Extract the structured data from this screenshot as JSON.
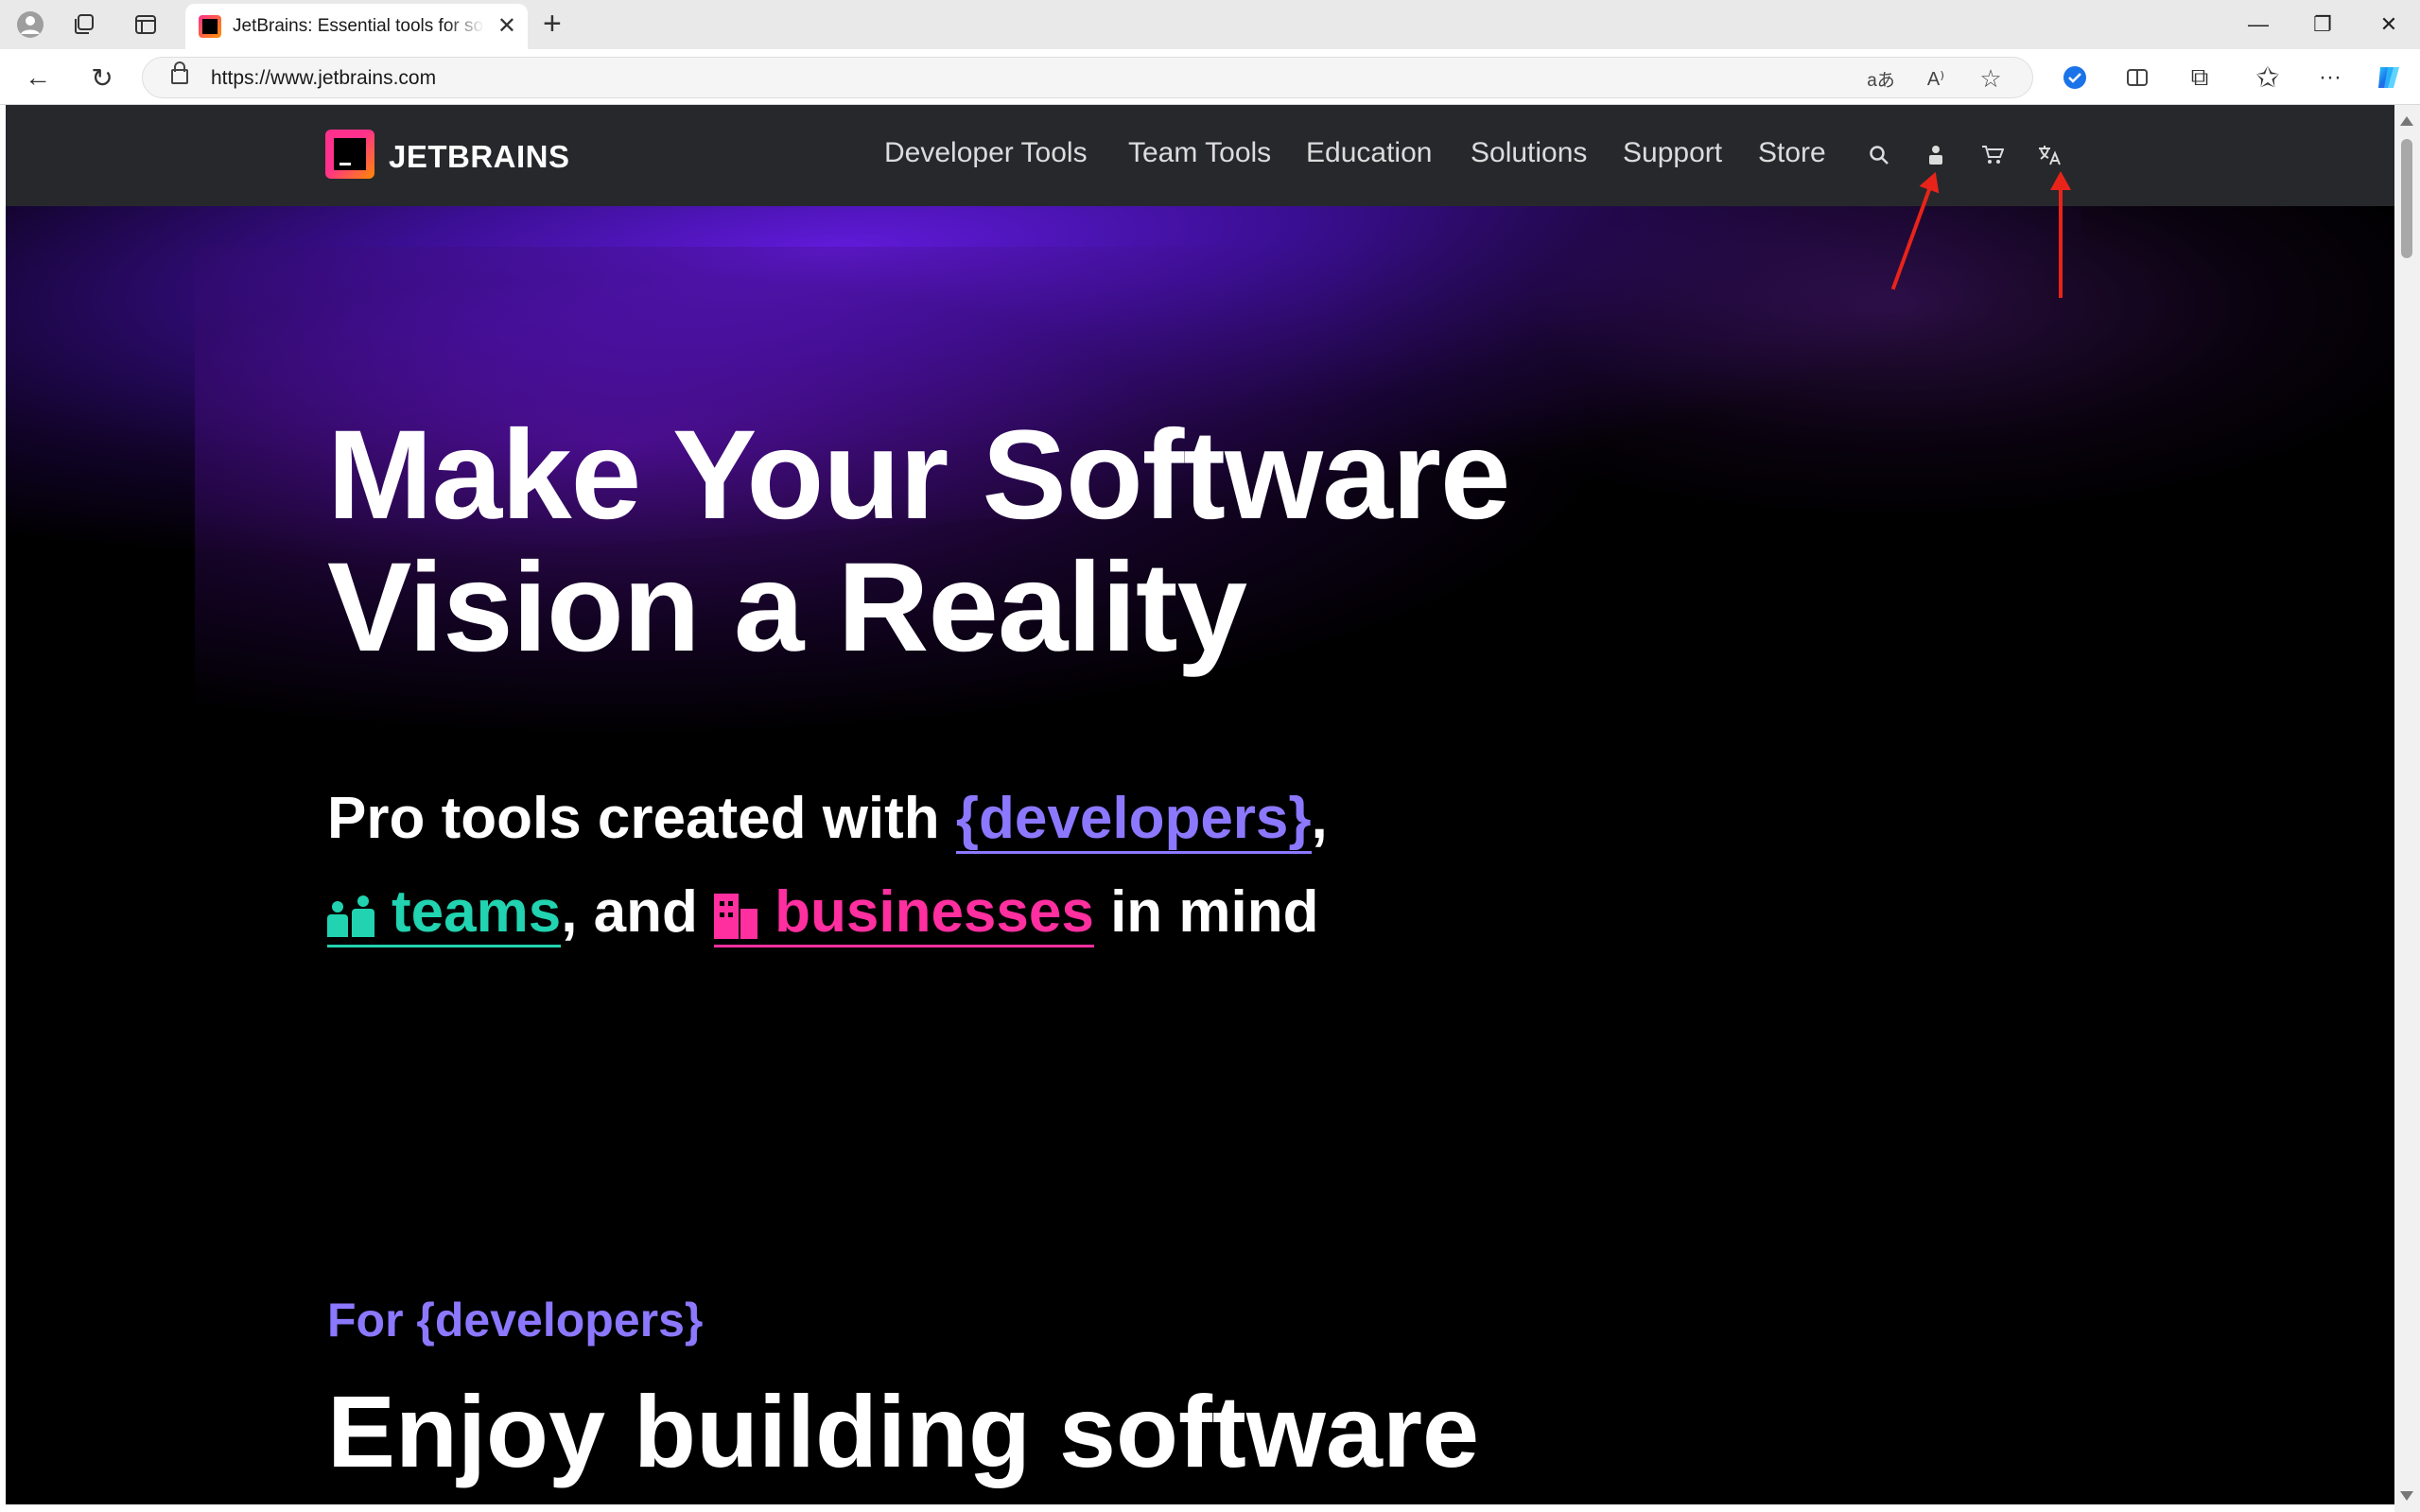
{
  "browser": {
    "tab_title": "JetBrains: Essential tools for software developers and teams",
    "url": "https://www.jetbrains.com",
    "icons": [
      "profile-icon",
      "workspaces-icon",
      "tab-actions-icon",
      "close-tab-icon",
      "new-tab-icon",
      "minimize-icon",
      "restore-icon",
      "close-window-icon",
      "back-icon",
      "refresh-icon",
      "lock-icon",
      "translate-page-icon",
      "read-aloud-icon",
      "favorite-icon",
      "extension-icon",
      "split-screen-icon",
      "extensions-icon",
      "favorites-icon",
      "more-icon",
      "copilot-icon"
    ],
    "glyphs": {
      "new_tab": "+",
      "close": "✕",
      "minimize": "—",
      "restore": "❐",
      "back": "←",
      "refresh": "↻",
      "translate": "aあ",
      "read_aloud": "A⁾",
      "favorite": "☆",
      "extensions": "⧉",
      "favorites": "✩",
      "more": "···"
    }
  },
  "site": {
    "logo_text": "JETBRAINS",
    "nav": [
      "Developer Tools",
      "Team Tools",
      "Education",
      "Solutions",
      "Support",
      "Store"
    ],
    "header_icons": [
      "search-icon",
      "account-icon",
      "cart-icon",
      "language-icon"
    ],
    "hero": {
      "title_line1": "Make Your Software",
      "title_line2": "Vision a Reality",
      "sub_prefix": "Pro tools created with ",
      "sub_developers": "{developers}",
      "sub_comma": ",",
      "sub_teams": "teams",
      "sub_and": ", and ",
      "sub_businesses": "businesses",
      "sub_suffix": " in mind"
    },
    "section": {
      "eyebrow": "For {developers}",
      "title": "Enjoy building software"
    },
    "colors": {
      "header_bg": "#27282c",
      "developers": "#8b78ff",
      "teams": "#21d3b0",
      "businesses": "#ff2fa0",
      "annotation_arrow": "#e8241a"
    }
  }
}
